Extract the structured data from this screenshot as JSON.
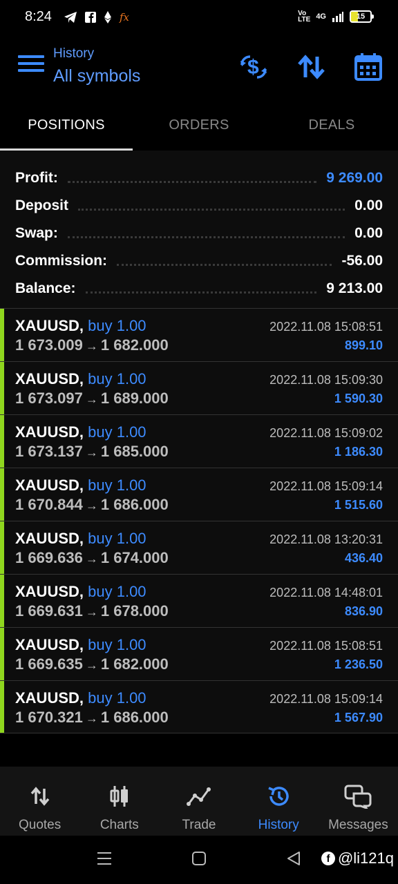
{
  "status_bar": {
    "time": "8:24",
    "network_label": "Vo LTE",
    "network_type": "4G",
    "battery_level": "15",
    "accent_color": "#e7e32e"
  },
  "appbar": {
    "subtitle": "History",
    "title": "All symbols",
    "accent": "#3d8bff"
  },
  "tabs": [
    {
      "label": "POSITIONS",
      "active": true
    },
    {
      "label": "ORDERS",
      "active": false
    },
    {
      "label": "DEALS",
      "active": false
    }
  ],
  "summary": {
    "profit": {
      "label": "Profit:",
      "value": "9 269.00"
    },
    "deposit": {
      "label": "Deposit",
      "value": "0.00"
    },
    "swap": {
      "label": "Swap:",
      "value": "0.00"
    },
    "commission": {
      "label": "Commission:",
      "value": "-56.00"
    },
    "balance": {
      "label": "Balance:",
      "value": "9 213.00"
    }
  },
  "positions": [
    {
      "symbol": "XAUUSD,",
      "side": "buy 1.00",
      "open": "1 673.009",
      "arrow": "→",
      "close": "1 682.000",
      "time": "2022.11.08 15:08:51",
      "profit": "899.10"
    },
    {
      "symbol": "XAUUSD,",
      "side": "buy 1.00",
      "open": "1 673.097",
      "arrow": "→",
      "close": "1 689.000",
      "time": "2022.11.08 15:09:30",
      "profit": "1 590.30"
    },
    {
      "symbol": "XAUUSD,",
      "side": "buy 1.00",
      "open": "1 673.137",
      "arrow": "→",
      "close": "1 685.000",
      "time": "2022.11.08 15:09:02",
      "profit": "1 186.30"
    },
    {
      "symbol": "XAUUSD,",
      "side": "buy 1.00",
      "open": "1 670.844",
      "arrow": "→",
      "close": "1 686.000",
      "time": "2022.11.08 15:09:14",
      "profit": "1 515.60"
    },
    {
      "symbol": "XAUUSD,",
      "side": "buy 1.00",
      "open": "1 669.636",
      "arrow": "→",
      "close": "1 674.000",
      "time": "2022.11.08 13:20:31",
      "profit": "436.40"
    },
    {
      "symbol": "XAUUSD,",
      "side": "buy 1.00",
      "open": "1 669.631",
      "arrow": "→",
      "close": "1 678.000",
      "time": "2022.11.08 14:48:01",
      "profit": "836.90"
    },
    {
      "symbol": "XAUUSD,",
      "side": "buy 1.00",
      "open": "1 669.635",
      "arrow": "→",
      "close": "1 682.000",
      "time": "2022.11.08 15:08:51",
      "profit": "1 236.50"
    },
    {
      "symbol": "XAUUSD,",
      "side": "buy 1.00",
      "open": "1 670.321",
      "arrow": "→",
      "close": "1 686.000",
      "time": "2022.11.08 15:09:14",
      "profit": "1 567.90"
    }
  ],
  "bottom_nav": [
    {
      "label": "Quotes",
      "icon": "sort-arrows-icon"
    },
    {
      "label": "Charts",
      "icon": "candlestick-icon"
    },
    {
      "label": "Trade",
      "icon": "trend-line-icon"
    },
    {
      "label": "History",
      "icon": "history-clock-icon",
      "active": true
    },
    {
      "label": "Messages",
      "icon": "chat-bubbles-icon"
    }
  ],
  "watermark": {
    "text": "@li121q"
  }
}
